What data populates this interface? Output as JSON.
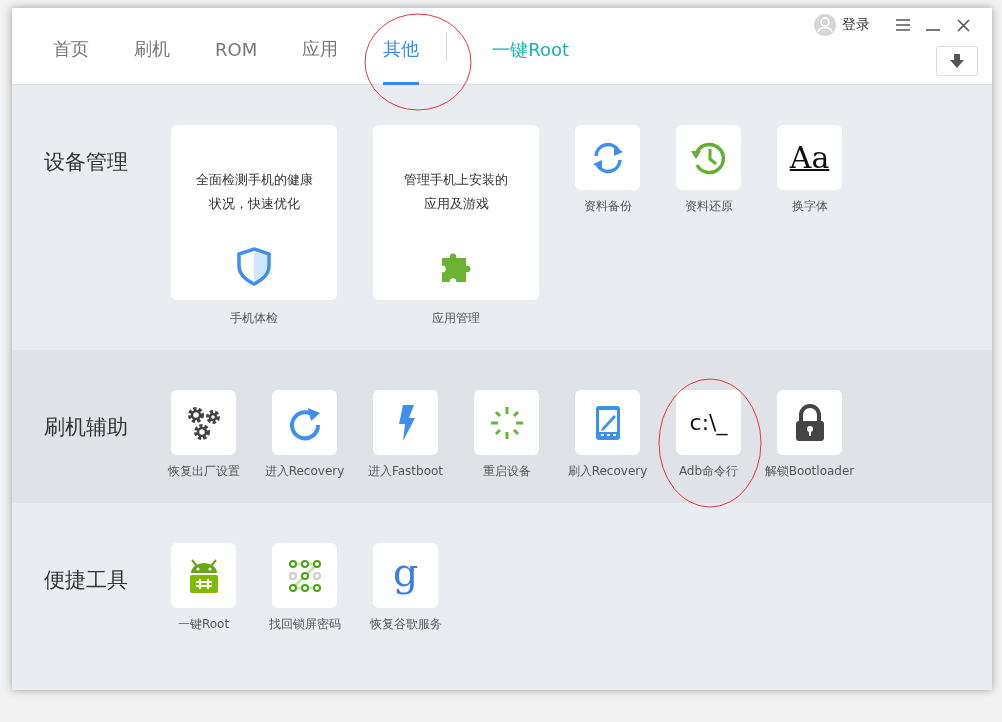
{
  "header": {
    "tabs": [
      {
        "label": "首页",
        "selected": false
      },
      {
        "label": "刷机",
        "selected": false
      },
      {
        "label": "ROM",
        "selected": false
      },
      {
        "label": "应用",
        "selected": false
      },
      {
        "label": "其他",
        "selected": true
      }
    ],
    "root_link": "一键Root",
    "login": "登录"
  },
  "sections": [
    {
      "title": "设备管理",
      "items": [
        {
          "kind": "card",
          "lines": [
            "全面检测手机的健康",
            "状况，快速优化"
          ],
          "label": "手机体检"
        },
        {
          "kind": "card",
          "lines": [
            "管理手机上安装的",
            "应用及游戏"
          ],
          "label": "应用管理"
        },
        {
          "kind": "tile",
          "label": "资料备份"
        },
        {
          "kind": "tile",
          "label": "资料还原"
        },
        {
          "kind": "tile",
          "glyph": "Aa",
          "label": "换字体"
        }
      ]
    },
    {
      "title": "刷机辅助",
      "items": [
        {
          "kind": "tile",
          "label": "恢复出厂设置"
        },
        {
          "kind": "tile",
          "label": "进入Recovery"
        },
        {
          "kind": "tile",
          "label": "进入Fastboot"
        },
        {
          "kind": "tile",
          "label": "重启设备"
        },
        {
          "kind": "tile",
          "label": "刷入Recovery"
        },
        {
          "kind": "tile",
          "glyph": "c:\\_",
          "label": "Adb命令行"
        },
        {
          "kind": "tile",
          "label": "解锁Bootloader"
        }
      ]
    },
    {
      "title": "便捷工具",
      "items": [
        {
          "kind": "tile",
          "label": "一键Root"
        },
        {
          "kind": "tile",
          "label": "找回锁屏密码"
        },
        {
          "kind": "tile",
          "glyph": "g",
          "label": "恢复谷歌服务"
        }
      ]
    }
  ]
}
